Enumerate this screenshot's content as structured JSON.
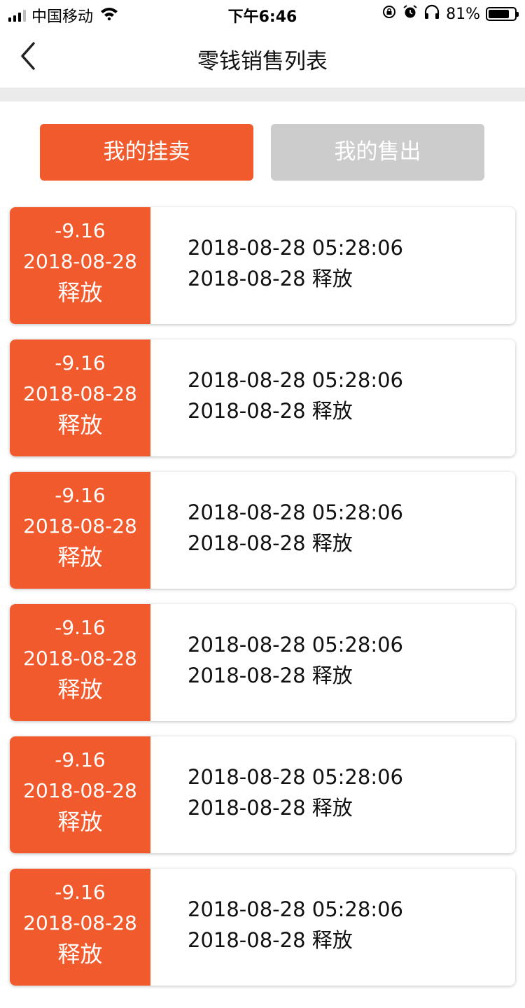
{
  "status_bar": {
    "carrier": "中国移动",
    "time": "下午6:46",
    "battery_percent": "81%",
    "battery_level": 0.81,
    "icons": [
      "signal-icon",
      "wifi-icon",
      "rotation-lock-icon",
      "alarm-icon",
      "headphones-icon",
      "battery-icon"
    ]
  },
  "nav": {
    "back_icon": "chevron-left-icon",
    "title": "零钱销售列表"
  },
  "tabs": [
    {
      "label": "我的挂卖",
      "active": true
    },
    {
      "label": "我的售出",
      "active": false
    }
  ],
  "colors": {
    "accent": "#f15a2c",
    "inactive_tab": "#cccccc",
    "divider": "#ebebeb"
  },
  "records": [
    {
      "amount": "-9.16",
      "date": "2018-08-28",
      "status": "释放",
      "datetime": "2018-08-28 05:28:06",
      "release_line": "2018-08-28 释放"
    },
    {
      "amount": "-9.16",
      "date": "2018-08-28",
      "status": "释放",
      "datetime": "2018-08-28 05:28:06",
      "release_line": "2018-08-28 释放"
    },
    {
      "amount": "-9.16",
      "date": "2018-08-28",
      "status": "释放",
      "datetime": "2018-08-28 05:28:06",
      "release_line": "2018-08-28 释放"
    },
    {
      "amount": "-9.16",
      "date": "2018-08-28",
      "status": "释放",
      "datetime": "2018-08-28 05:28:06",
      "release_line": "2018-08-28 释放"
    },
    {
      "amount": "-9.16",
      "date": "2018-08-28",
      "status": "释放",
      "datetime": "2018-08-28 05:28:06",
      "release_line": "2018-08-28 释放"
    },
    {
      "amount": "-9.16",
      "date": "2018-08-28",
      "status": "释放",
      "datetime": "2018-08-28 05:28:06",
      "release_line": "2018-08-28 释放"
    }
  ]
}
